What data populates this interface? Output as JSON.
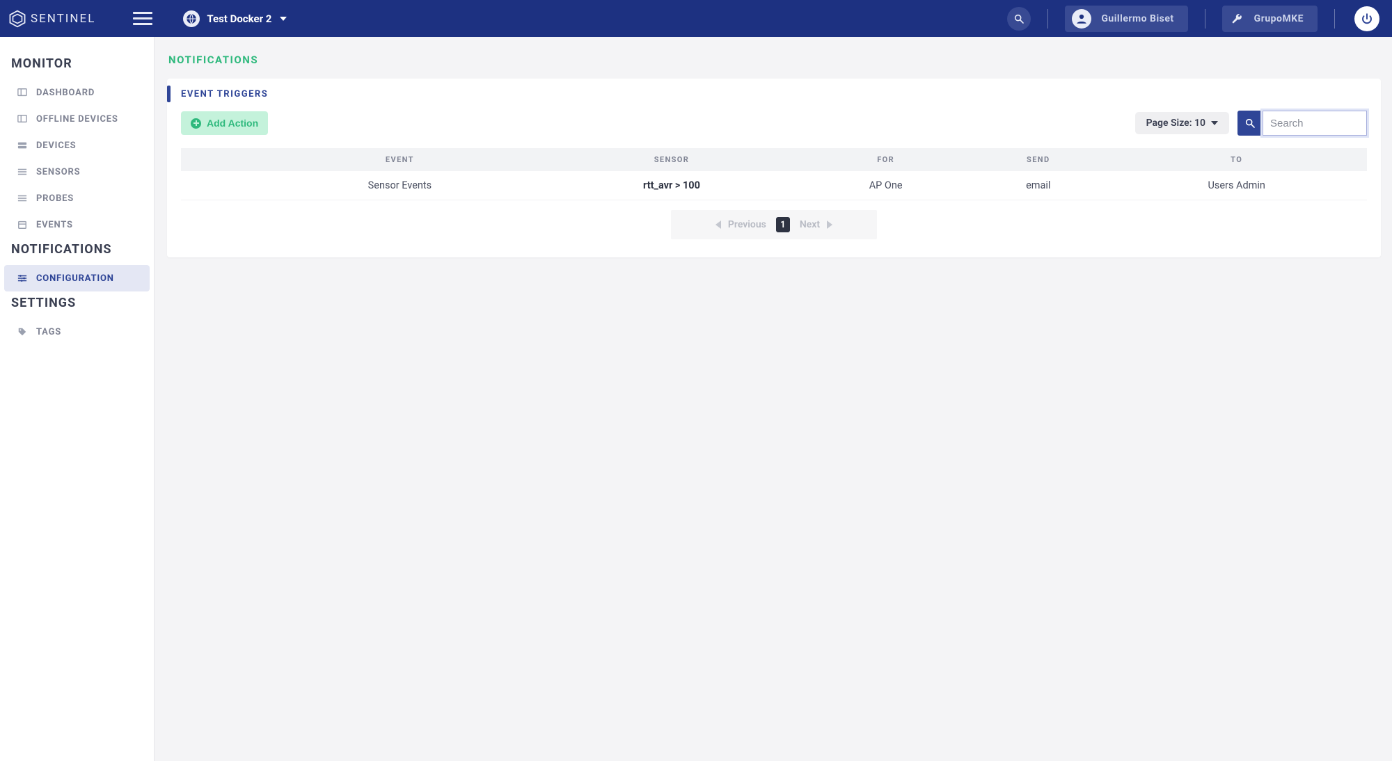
{
  "brand": {
    "name": "SENTINEL"
  },
  "header": {
    "context_label": "Test Docker 2",
    "user_name": "Guillermo Biset",
    "org_name": "GrupoMKE"
  },
  "sidebar": {
    "sections": [
      {
        "title": "MONITOR",
        "items": [
          {
            "label": "DASHBOARD",
            "icon": "dashboard-icon"
          },
          {
            "label": "OFFLINE DEVICES",
            "icon": "dashboard-icon"
          },
          {
            "label": "DEVICES",
            "icon": "server-icon"
          },
          {
            "label": "SENSORS",
            "icon": "sliders-icon"
          },
          {
            "label": "PROBES",
            "icon": "sliders-icon"
          },
          {
            "label": "EVENTS",
            "icon": "calendar-icon"
          }
        ]
      },
      {
        "title": "NOTIFICATIONS",
        "items": [
          {
            "label": "CONFIGURATION",
            "icon": "sliders-icon",
            "active": true
          }
        ]
      },
      {
        "title": "SETTINGS",
        "items": [
          {
            "label": "TAGS",
            "icon": "tag-icon"
          }
        ]
      }
    ]
  },
  "page": {
    "title": "NOTIFICATIONS",
    "card_title": "EVENT TRIGGERS",
    "add_action_label": "Add Action",
    "page_size_label": "Page Size: 10",
    "search_placeholder": "Search",
    "columns": [
      "",
      "EVENT",
      "SENSOR",
      "FOR",
      "SEND",
      "TO"
    ],
    "rows": [
      {
        "event": "Sensor Events",
        "sensor": "rtt_avr > 100",
        "for": "AP One",
        "send": "email",
        "to": "Users Admin"
      }
    ],
    "pager": {
      "prev": "Previous",
      "next": "Next",
      "page": "1"
    }
  }
}
